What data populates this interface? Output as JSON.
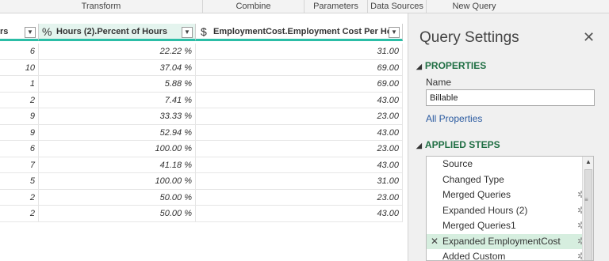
{
  "ribbon": {
    "groups": [
      "Transform",
      "Combine",
      "Parameters",
      "Data Sources",
      "New Query"
    ]
  },
  "grid": {
    "columns": [
      {
        "type_icon": "",
        "label": "rs"
      },
      {
        "type_icon": "%",
        "label": "Hours (2).Percent of Hours"
      },
      {
        "type_icon": "$",
        "label": "EmploymentCost.Employment Cost Per Ho..."
      }
    ],
    "dropdown_glyph": "▼",
    "rows": [
      [
        "6",
        "22.22 %",
        "31.00"
      ],
      [
        "10",
        "37.04 %",
        "69.00"
      ],
      [
        "1",
        "5.88 %",
        "69.00"
      ],
      [
        "2",
        "7.41 %",
        "43.00"
      ],
      [
        "9",
        "33.33 %",
        "23.00"
      ],
      [
        "9",
        "52.94 %",
        "43.00"
      ],
      [
        "6",
        "100.00 %",
        "23.00"
      ],
      [
        "7",
        "41.18 %",
        "43.00"
      ],
      [
        "5",
        "100.00 %",
        "31.00"
      ],
      [
        "2",
        "50.00 %",
        "23.00"
      ],
      [
        "2",
        "50.00 %",
        "43.00"
      ]
    ]
  },
  "query_settings": {
    "title": "Query Settings",
    "close_glyph": "✕",
    "properties_heading": "PROPERTIES",
    "name_label": "Name",
    "name_value": "Billable",
    "all_properties": "All Properties",
    "applied_steps_heading": "APPLIED STEPS",
    "collapse_glyph": "◢",
    "steps": [
      {
        "label": "Source",
        "has_gear": false,
        "selected": false
      },
      {
        "label": "Changed Type",
        "has_gear": false,
        "selected": false
      },
      {
        "label": "Merged Queries",
        "has_gear": true,
        "selected": false
      },
      {
        "label": "Expanded Hours (2)",
        "has_gear": true,
        "selected": false
      },
      {
        "label": "Merged Queries1",
        "has_gear": true,
        "selected": false
      },
      {
        "label": "Expanded EmploymentCost",
        "has_gear": true,
        "selected": true
      },
      {
        "label": "Added Custom",
        "has_gear": true,
        "selected": false
      }
    ],
    "delete_glyph": "✕",
    "gear_glyph": "✲"
  },
  "colors": {
    "header_accent": "#2bbda6",
    "section_heading": "#1f6e43",
    "selected_step": "#d6eedf",
    "link": "#2a5aa0"
  }
}
